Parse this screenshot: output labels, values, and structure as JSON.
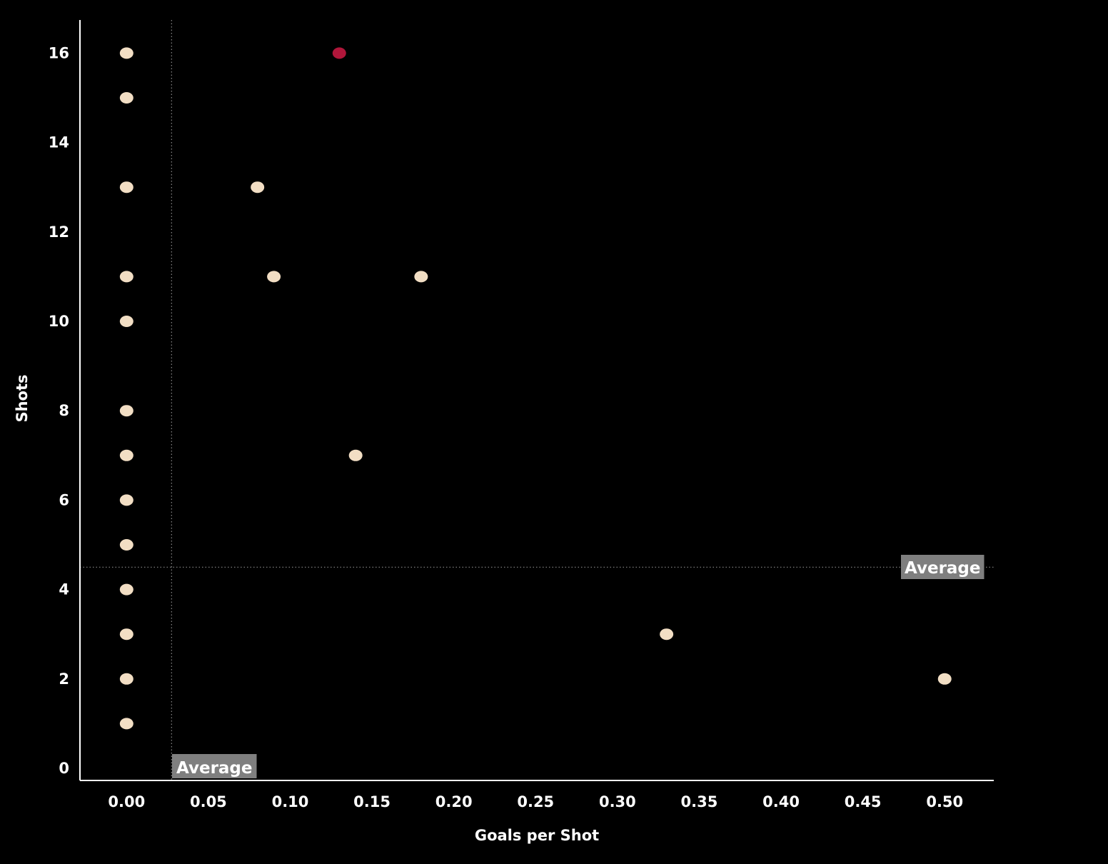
{
  "chart_data": {
    "type": "scatter",
    "xlabel": "Goals per Shot",
    "ylabel": "Shots",
    "xlim": [
      -0.0285,
      0.53
    ],
    "ylim": [
      0,
      17
    ],
    "x_ticks": [
      "0.00",
      "0.05",
      "0.10",
      "0.15",
      "0.20",
      "0.25",
      "0.30",
      "0.35",
      "0.40",
      "0.45",
      "0.50"
    ],
    "y_ticks": [
      "0",
      "2",
      "4",
      "6",
      "8",
      "10",
      "12",
      "14",
      "16"
    ],
    "grid": false,
    "colors": {
      "background": "#000000",
      "point": "#F2DEC4",
      "highlight": "#B0163A",
      "axis": "#ffffff",
      "reference": "#8a8a8a",
      "label_bg": "#7f7f7f"
    },
    "reference_lines": [
      {
        "axis": "x",
        "value": 0.0275,
        "label": "Average"
      },
      {
        "axis": "y",
        "value": 4.5,
        "label": "Average"
      }
    ],
    "points": [
      {
        "x": 0.0,
        "y": 16
      },
      {
        "x": 0.0,
        "y": 15
      },
      {
        "x": 0.0,
        "y": 13
      },
      {
        "x": 0.0,
        "y": 11
      },
      {
        "x": 0.0,
        "y": 10
      },
      {
        "x": 0.0,
        "y": 8
      },
      {
        "x": 0.0,
        "y": 7
      },
      {
        "x": 0.0,
        "y": 6
      },
      {
        "x": 0.0,
        "y": 5
      },
      {
        "x": 0.0,
        "y": 4
      },
      {
        "x": 0.0,
        "y": 3
      },
      {
        "x": 0.0,
        "y": 2
      },
      {
        "x": 0.0,
        "y": 1
      },
      {
        "x": 0.13,
        "y": 16,
        "highlight": true
      },
      {
        "x": 0.08,
        "y": 13
      },
      {
        "x": 0.09,
        "y": 11
      },
      {
        "x": 0.18,
        "y": 11
      },
      {
        "x": 0.14,
        "y": 7
      },
      {
        "x": 0.33,
        "y": 3
      },
      {
        "x": 0.5,
        "y": 2
      }
    ]
  }
}
